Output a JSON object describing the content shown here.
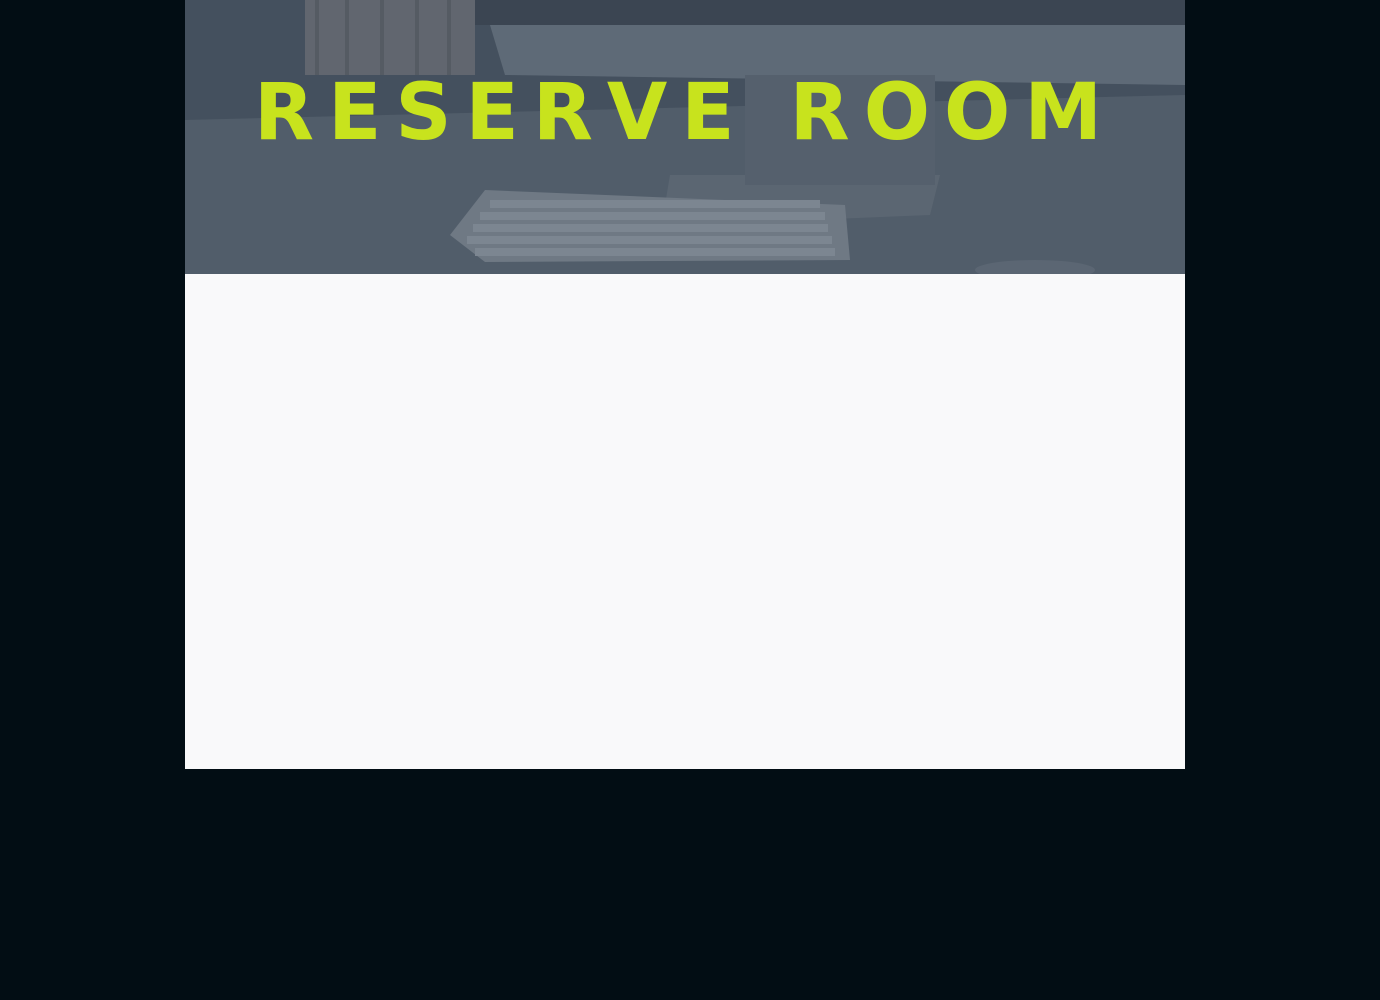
{
  "hero": {
    "title": "Reserve Room",
    "background_image": "desk-with-monitor-and-keyboard"
  },
  "colors": {
    "page_background": "#020d14",
    "title_color": "#c8e31d",
    "panel_background": "#f9f9fa",
    "hero_overlay": "#5b6875"
  }
}
